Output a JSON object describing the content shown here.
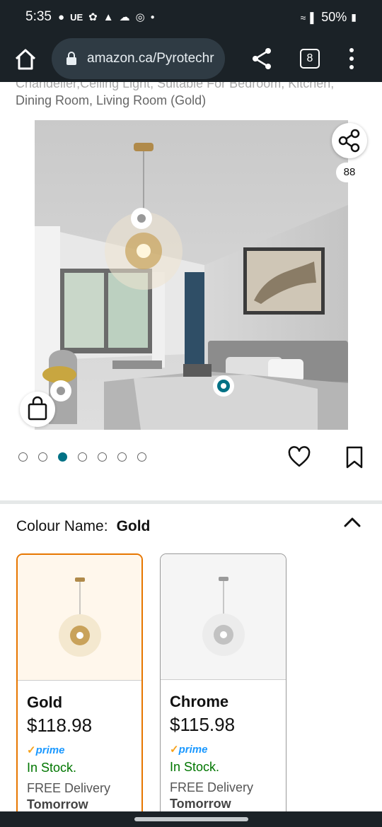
{
  "status_bar": {
    "time": "5:35",
    "left_icons_text": "UE",
    "battery": "50%"
  },
  "browser": {
    "url": "amazon.ca/Pyrotechr",
    "tab_count": "8"
  },
  "product": {
    "title_line1": "Chandelier,Ceiling Light, Suitable For Bedroom, Kitchen,",
    "title_line2": "Dining Room, Living Room (Gold)",
    "share_count": "88",
    "image_count": 7,
    "active_image_index": 2
  },
  "colour": {
    "label": "Colour Name:",
    "selected": "Gold"
  },
  "variants": [
    {
      "name": "Gold",
      "price": "$118.98",
      "prime": "prime",
      "stock": "In Stock.",
      "delivery": "FREE Delivery",
      "delivery_day": "Tomorrow"
    },
    {
      "name": "Chrome",
      "price": "$115.98",
      "prime": "prime",
      "stock": "In Stock.",
      "delivery": "FREE Delivery",
      "delivery_day": "Tomorrow"
    }
  ],
  "colors": {
    "accent_teal": "#007185",
    "selected_border": "#e77600",
    "in_stock": "#007600",
    "prime_blue": "#1a98ff",
    "chrome_bg": "#1b2227"
  }
}
